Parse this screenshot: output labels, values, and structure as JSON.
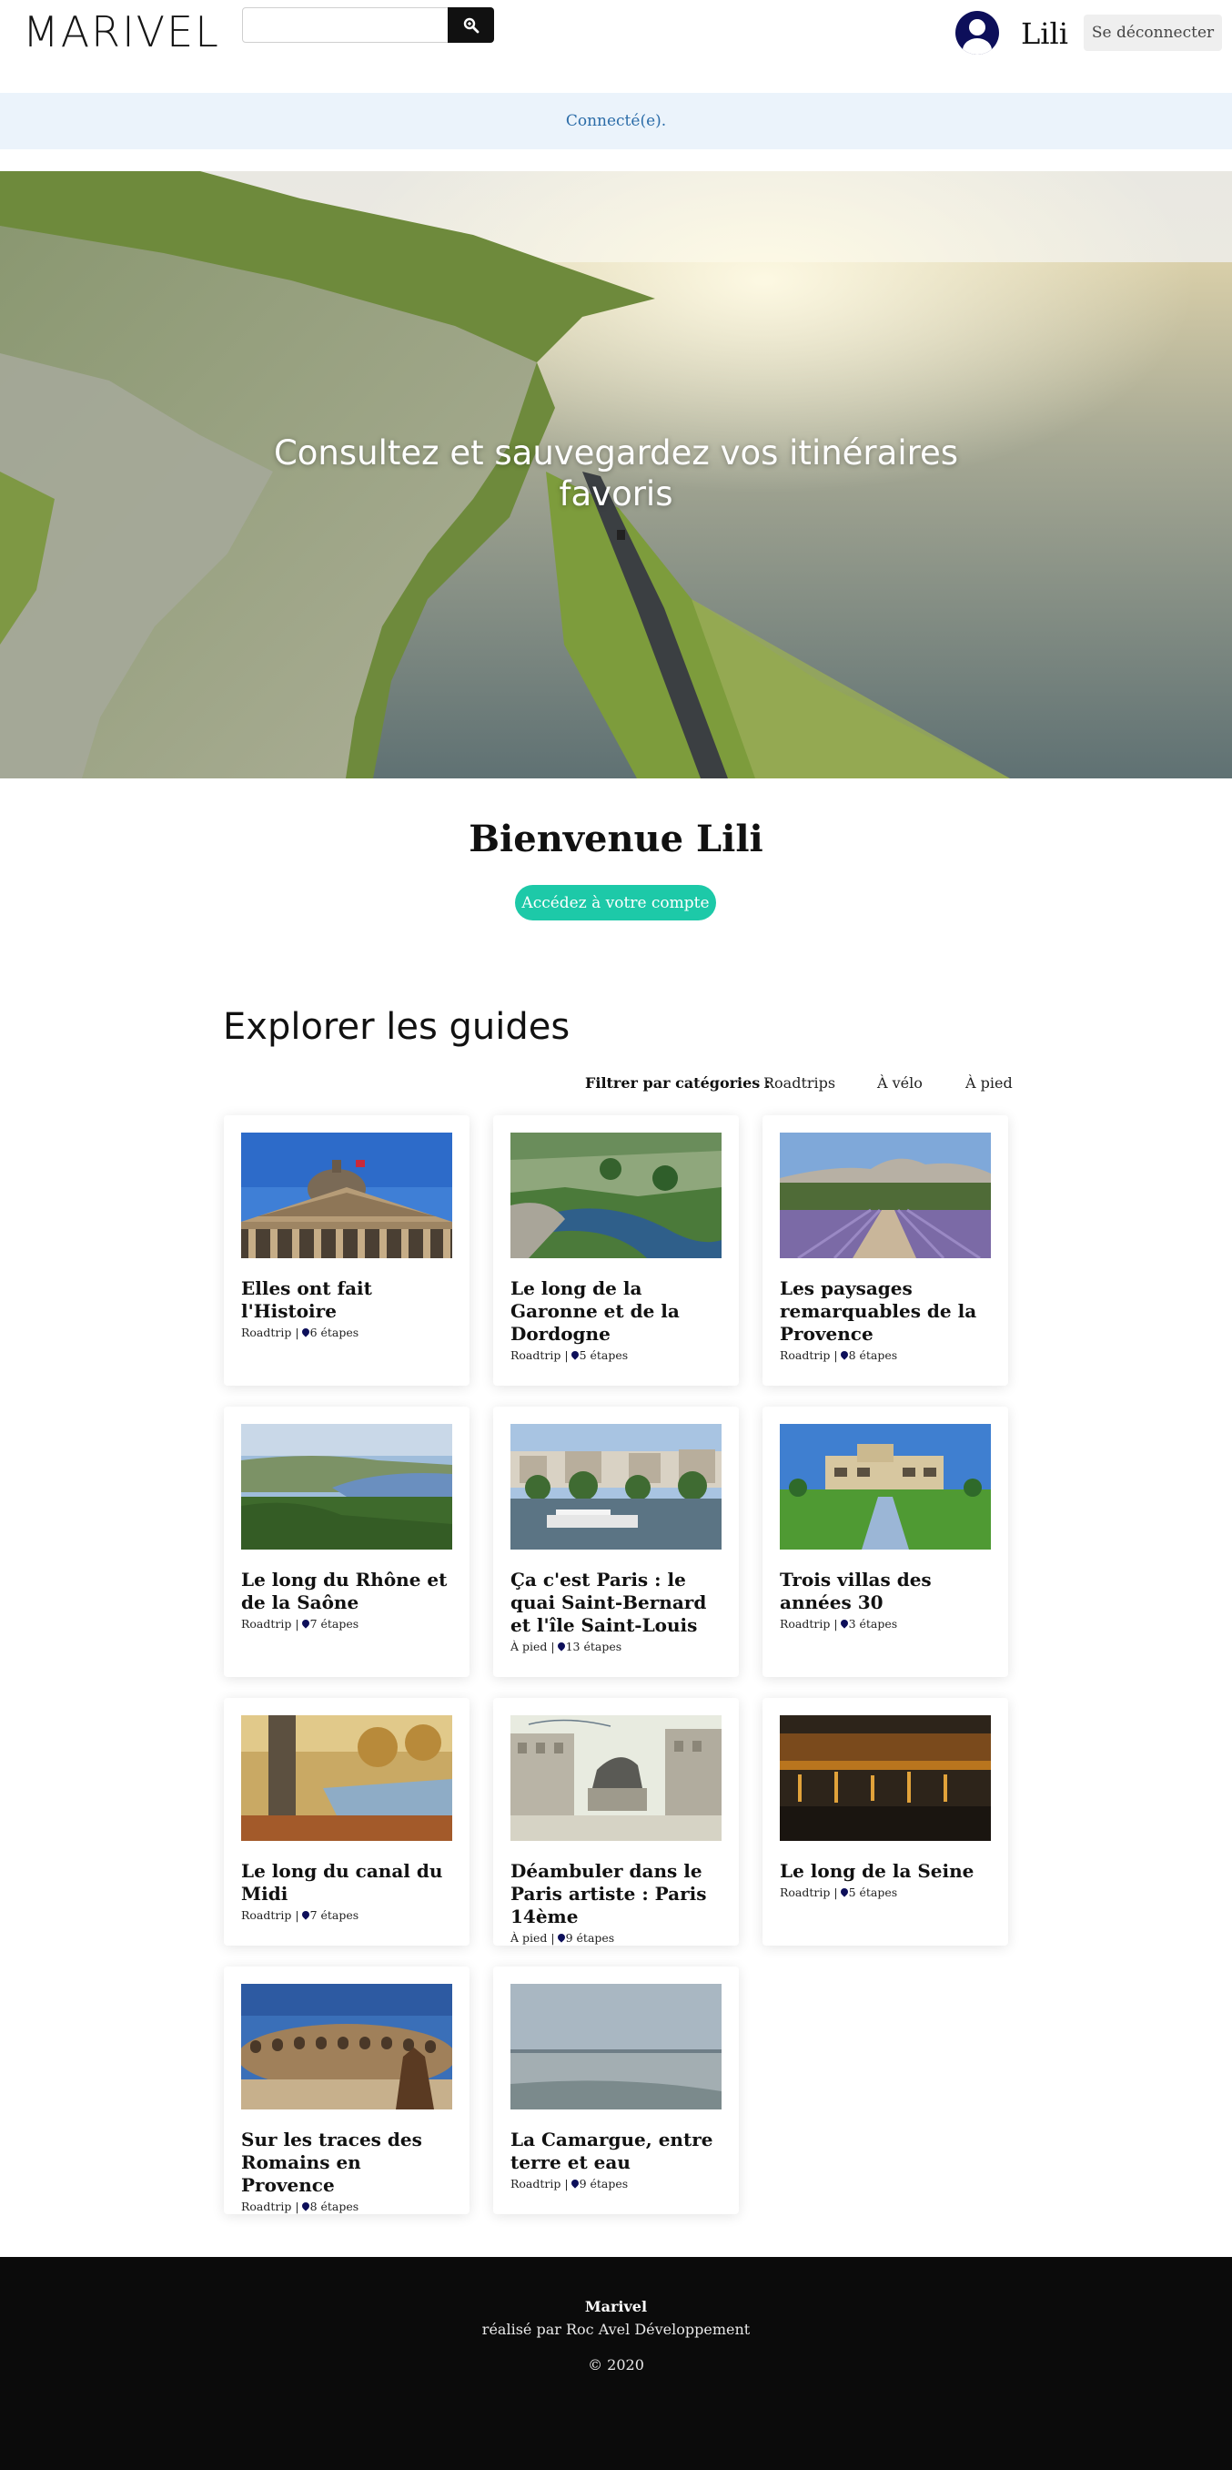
{
  "header": {
    "logo": "MARIVEL",
    "search": {
      "value": "",
      "placeholder": ""
    },
    "search_icon": "search-icon",
    "avatar_icon": "user-circle-icon",
    "username": "Lili",
    "logout_label": "Se déconnecter"
  },
  "flash": {
    "message": "Connecté(e)."
  },
  "hero": {
    "title": "Consultez et sauvegardez vos itinéraires favoris"
  },
  "welcome": {
    "title": "Bienvenue Lili",
    "account_button": "Accédez à votre compte"
  },
  "guides": {
    "title": "Explorer les guides",
    "filter_label": "Filtrer par catégories :",
    "filters": [
      "Roadtrips",
      "À vélo",
      "À pied"
    ],
    "pin_icon": "map-marker-icon",
    "items": [
      {
        "title": "Elles ont fait l'Histoire",
        "category": "Roadtrip",
        "steps": "6 étapes"
      },
      {
        "title": "Le long de la Garonne et de la Dordogne",
        "category": "Roadtrip",
        "steps": "5 étapes"
      },
      {
        "title": "Les paysages remarquables de la Provence",
        "category": "Roadtrip",
        "steps": "8 étapes"
      },
      {
        "title": "Le long du Rhône et de la Saône",
        "category": "Roadtrip",
        "steps": "7 étapes"
      },
      {
        "title": "Ça c'est Paris : le quai Saint-Bernard et l'île Saint-Louis",
        "category": "À pied",
        "steps": "13 étapes"
      },
      {
        "title": "Trois villas des années 30",
        "category": "Roadtrip",
        "steps": "3 étapes"
      },
      {
        "title": "Le long du canal du Midi",
        "category": "Roadtrip",
        "steps": "7 étapes"
      },
      {
        "title": "Déambuler dans le Paris artiste : Paris 14ème",
        "category": "À pied",
        "steps": "9 étapes"
      },
      {
        "title": "Le long de la Seine",
        "category": "Roadtrip",
        "steps": "5 étapes"
      },
      {
        "title": "Sur les traces des Romains en Provence",
        "category": "Roadtrip",
        "steps": "8 étapes"
      },
      {
        "title": "La Camargue, entre terre et eau",
        "category": "Roadtrip",
        "steps": "9 étapes"
      }
    ]
  },
  "footer": {
    "brand": "Marivel",
    "credit": "réalisé par Roc Avel Développement",
    "copyright": "© 2020"
  },
  "colors": {
    "accent": "#1dc9a8",
    "navy": "#0d0f5a",
    "flash_bg": "#ebf3fb",
    "flash_text": "#2b6ca8",
    "footer_bg": "#0b0b0b"
  }
}
